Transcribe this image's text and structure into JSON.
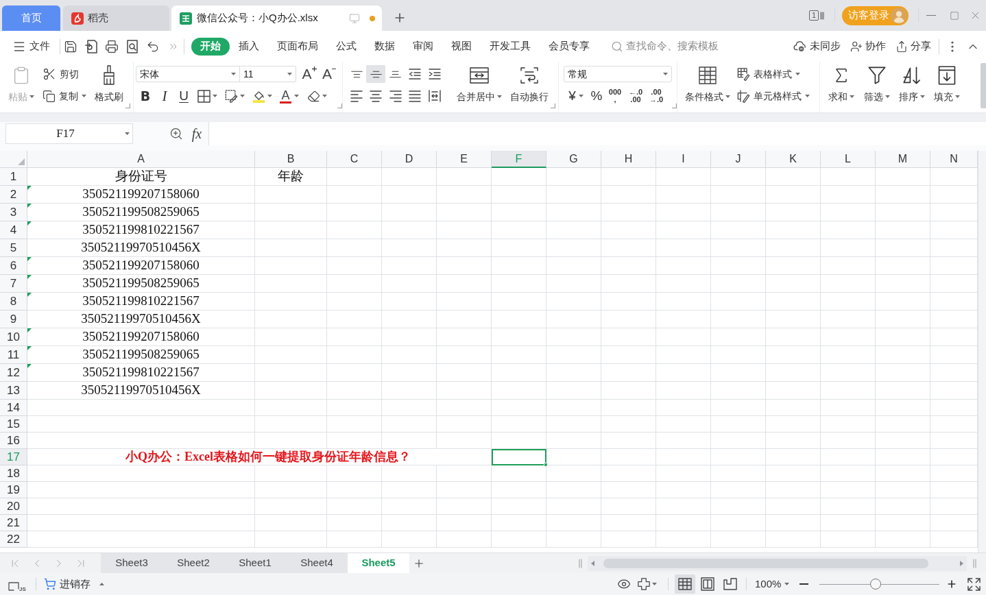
{
  "title_bar": {
    "tabs": [
      {
        "kind": "home",
        "label": "首页",
        "selected": false
      },
      {
        "kind": "docer",
        "label": "稻壳",
        "selected": false
      },
      {
        "kind": "document",
        "label": "微信公众号：小Q办公.xlsx",
        "selected": true,
        "unsaved": true
      }
    ],
    "window_count": "1",
    "login_button": "访客登录"
  },
  "menu_bar": {
    "file_menu": "文件",
    "tabs": [
      {
        "label": "开始",
        "selected": true
      },
      {
        "label": "插入",
        "selected": false
      },
      {
        "label": "页面布局",
        "selected": false
      },
      {
        "label": "公式",
        "selected": false
      },
      {
        "label": "数据",
        "selected": false
      },
      {
        "label": "审阅",
        "selected": false
      },
      {
        "label": "视图",
        "selected": false
      },
      {
        "label": "开发工具",
        "selected": false
      },
      {
        "label": "会员专享",
        "selected": false
      }
    ],
    "search": {
      "placeholder": "查找命令、搜索模板"
    },
    "actions": [
      {
        "kind": "sync",
        "label": "未同步"
      },
      {
        "kind": "collaborate",
        "label": "协作"
      },
      {
        "kind": "share",
        "label": "分享"
      }
    ]
  },
  "ribbon": {
    "clipboard": {
      "paste": {
        "label": "粘贴",
        "disabled": true
      },
      "cut": "剪切",
      "copy": "复制",
      "format_painter": "格式刷"
    },
    "font": {
      "family": "宋体",
      "size": "11",
      "resize_buttons": [
        {
          "kind": "grow",
          "label": "A"
        },
        {
          "kind": "shrink",
          "label": "A"
        }
      ],
      "style_buttons": [
        {
          "kind": "bold",
          "label": "B"
        },
        {
          "kind": "italic",
          "label": "I"
        },
        {
          "kind": "underline",
          "label": "U"
        }
      ],
      "color_label": "A"
    },
    "alignment": {
      "buttons": [
        {
          "kind": "top",
          "selected": false
        },
        {
          "kind": "middle",
          "selected": true
        },
        {
          "kind": "bottom",
          "selected": false
        },
        {
          "kind": "outdent",
          "selected": false
        },
        {
          "kind": "indent",
          "selected": false
        },
        {
          "kind": "left",
          "selected": false
        },
        {
          "kind": "center",
          "selected": false
        },
        {
          "kind": "right",
          "selected": false
        },
        {
          "kind": "justify",
          "selected": false
        },
        {
          "kind": "distributed",
          "selected": false
        }
      ],
      "merge": "合并居中",
      "wrap": "自动换行"
    },
    "number": {
      "format": "常规",
      "buttons": [
        {
          "kind": "currency",
          "lines": [
            "¥"
          ]
        },
        {
          "kind": "percent",
          "lines": [
            "%"
          ]
        },
        {
          "kind": "thousands",
          "lines": [
            "000",
            ","
          ]
        },
        {
          "kind": "add_decimal",
          "lines": [
            "←.0",
            ".00"
          ]
        },
        {
          "kind": "remove_decimal",
          "lines": [
            ".00",
            "→.0"
          ]
        }
      ]
    },
    "styles": {
      "conditional": "条件格式",
      "table_style": "表格样式",
      "cell_style": "单元格样式"
    },
    "editing": [
      {
        "kind": "sum",
        "label": "求和"
      },
      {
        "kind": "filter",
        "label": "筛选"
      },
      {
        "kind": "sort",
        "label": "排序"
      },
      {
        "kind": "fill",
        "label": "填充"
      }
    ]
  },
  "formula_bar": {
    "name_box": "F17",
    "fx_label": "fx"
  },
  "sheet": {
    "columns": [
      {
        "label": "A",
        "selected": false
      },
      {
        "label": "B",
        "selected": false
      },
      {
        "label": "C",
        "selected": false
      },
      {
        "label": "D",
        "selected": false
      },
      {
        "label": "E",
        "selected": false
      },
      {
        "label": "F",
        "selected": true
      },
      {
        "label": "G",
        "selected": false
      },
      {
        "label": "H",
        "selected": false
      },
      {
        "label": "I",
        "selected": false
      },
      {
        "label": "J",
        "selected": false
      },
      {
        "label": "K",
        "selected": false
      },
      {
        "label": "L",
        "selected": false
      },
      {
        "label": "M",
        "selected": false
      },
      {
        "label": "N",
        "selected": false
      }
    ],
    "rows": [
      {
        "number": "1",
        "selected": false,
        "flag": false,
        "cells": [
          "身份证号",
          "年龄"
        ]
      },
      {
        "number": "2",
        "selected": false,
        "flag": true,
        "cells": [
          "350521199207158060"
        ]
      },
      {
        "number": "3",
        "selected": false,
        "flag": true,
        "cells": [
          "350521199508259065"
        ]
      },
      {
        "number": "4",
        "selected": false,
        "flag": true,
        "cells": [
          "350521199810221567"
        ]
      },
      {
        "number": "5",
        "selected": false,
        "flag": false,
        "cells": [
          "35052119970510456X"
        ]
      },
      {
        "number": "6",
        "selected": false,
        "flag": true,
        "cells": [
          "350521199207158060"
        ]
      },
      {
        "number": "7",
        "selected": false,
        "flag": true,
        "cells": [
          "350521199508259065"
        ]
      },
      {
        "number": "8",
        "selected": false,
        "flag": true,
        "cells": [
          "350521199810221567"
        ]
      },
      {
        "number": "9",
        "selected": false,
        "flag": false,
        "cells": [
          "35052119970510456X"
        ]
      },
      {
        "number": "10",
        "selected": false,
        "flag": true,
        "cells": [
          "350521199207158060"
        ]
      },
      {
        "number": "11",
        "selected": false,
        "flag": true,
        "cells": [
          "350521199508259065"
        ]
      },
      {
        "number": "12",
        "selected": false,
        "flag": true,
        "cells": [
          "350521199810221567"
        ]
      },
      {
        "number": "13",
        "selected": false,
        "flag": false,
        "cells": [
          "35052119970510456X"
        ]
      },
      {
        "number": "14",
        "selected": false,
        "flag": false
      },
      {
        "number": "15",
        "selected": false,
        "flag": false
      },
      {
        "number": "16",
        "selected": false,
        "flag": false
      },
      {
        "number": "17",
        "selected": true,
        "flag": false,
        "banner": "小Q办公：Excel表格如何一键提取身份证年龄信息？"
      },
      {
        "number": "18",
        "selected": false,
        "flag": false
      },
      {
        "number": "19",
        "selected": false,
        "flag": false
      },
      {
        "number": "20",
        "selected": false,
        "flag": false
      },
      {
        "number": "21",
        "selected": false,
        "flag": false
      },
      {
        "number": "22",
        "selected": false,
        "flag": false
      }
    ]
  },
  "sheet_tabs": {
    "tabs": [
      {
        "label": "Sheet3",
        "selected": false
      },
      {
        "label": "Sheet2",
        "selected": false
      },
      {
        "label": "Sheet1",
        "selected": false
      },
      {
        "label": "Sheet4",
        "selected": false
      },
      {
        "label": "Sheet5",
        "selected": true
      }
    ]
  },
  "status_bar": {
    "macro_label": "JS",
    "app_button": "进销存",
    "views": [
      {
        "kind": "normal",
        "selected": true
      },
      {
        "kind": "page_break",
        "selected": false
      },
      {
        "kind": "page_layout",
        "selected": false
      }
    ],
    "zoom": "100%",
    "zoom_slider": {
      "level": 0.47
    }
  }
}
